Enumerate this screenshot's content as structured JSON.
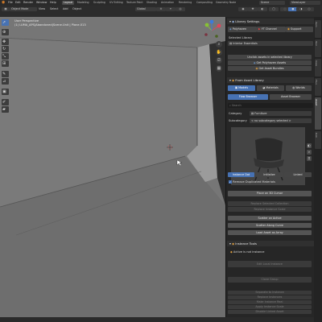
{
  "menubar": {
    "items": [
      "File",
      "Edit",
      "Render",
      "Window",
      "Help"
    ],
    "workspaces": [
      "Layout",
      "Modeling",
      "Sculpting",
      "UV Editing",
      "Texture Paint",
      "Shading",
      "Animation",
      "Rendering",
      "Compositing",
      "Geometry Node"
    ],
    "scene": "Scene",
    "view_layer": "ViewLayer"
  },
  "header": {
    "mode": "Object Mode",
    "menus": [
      "View",
      "Select",
      "Add",
      "Object"
    ],
    "orientation": "Global"
  },
  "viewport": {
    "view_name": "User Perspective",
    "collection": "(1) LUMA_APS|Abandoned|Scene.Unit | Plane.013"
  },
  "panel": {
    "library_settings": {
      "title": "Library Settings",
      "buttons": [
        "Polyhaven",
        "YT Channel",
        "Support"
      ]
    },
    "selected_library": {
      "label": "Selected Library",
      "value": "Interior Essentials",
      "actions": [
        "Unclick assets in selected library",
        "Get Polyhaven Assets",
        "Get Asset Bundles"
      ]
    },
    "asset_library": {
      "title": "From Asset Library",
      "types": [
        "Models",
        "Materials",
        "Worlds"
      ],
      "browser_buttons": [
        "Flow Browser",
        "Asset Browser"
      ],
      "search_placeholder": "Search",
      "category_label": "Category",
      "category_value": "Furniture",
      "subcategory_label": "Subcategory",
      "subcategory_value": "< no subcategory selected >",
      "modes": [
        "Instance Dot",
        "Initialize",
        "Linked"
      ],
      "remove_duplicates": "Remove Duplicated Materials",
      "place_button": "Place on 3D Cursor",
      "disabled_buttons": [
        "Replace Selected Collection",
        "Replace Instance Scale"
      ],
      "scatter_buttons": [
        "Scatter on Active",
        "Scatter Along Curve",
        "Load Asset as Array"
      ]
    },
    "instance_tools": {
      "title": "Instance Tools",
      "status": "Active is not instance",
      "disabled_buttons": [
        "Edit Local Instance",
        "Clone Group",
        "Separate to Instance",
        "Replace Instances",
        "Make Instance Real",
        "Apply Instance Scale",
        "Disable Linked Asset"
      ]
    }
  },
  "sidebar_tabs": [
    "Item",
    "Tool",
    "View",
    "Flux",
    "Asset",
    "Edit"
  ],
  "colors": {
    "accent": "#4772b3",
    "viewport_wall": "#767676",
    "viewport_floor": "#6f6f6f",
    "panel_bg": "#262626",
    "x_axis": "#e0455a",
    "y_axis": "#87c234",
    "z_axis": "#3d7bd9"
  }
}
